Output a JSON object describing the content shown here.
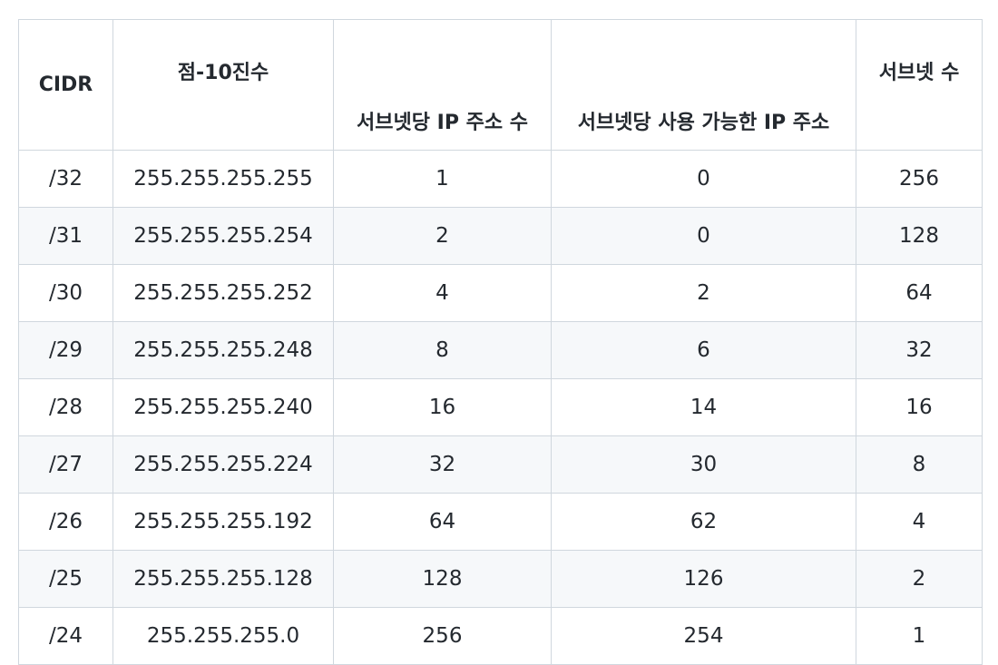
{
  "table": {
    "headers": [
      "CIDR",
      "점-10진수",
      "서브넷당 IP 주소 수",
      "서브넷당 사용 가능한 IP 주소",
      "서브넷 수"
    ],
    "rows": [
      [
        "/32",
        "255.255.255.255",
        "1",
        "0",
        "256"
      ],
      [
        "/31",
        "255.255.255.254",
        "2",
        "0",
        "128"
      ],
      [
        "/30",
        "255.255.255.252",
        "4",
        "2",
        "64"
      ],
      [
        "/29",
        "255.255.255.248",
        "8",
        "6",
        "32"
      ],
      [
        "/28",
        "255.255.255.240",
        "16",
        "14",
        "16"
      ],
      [
        "/27",
        "255.255.255.224",
        "32",
        "30",
        "8"
      ],
      [
        "/26",
        "255.255.255.192",
        "64",
        "62",
        "4"
      ],
      [
        "/25",
        "255.255.255.128",
        "128",
        "126",
        "2"
      ],
      [
        "/24",
        "255.255.255.0",
        "256",
        "254",
        "1"
      ]
    ]
  }
}
